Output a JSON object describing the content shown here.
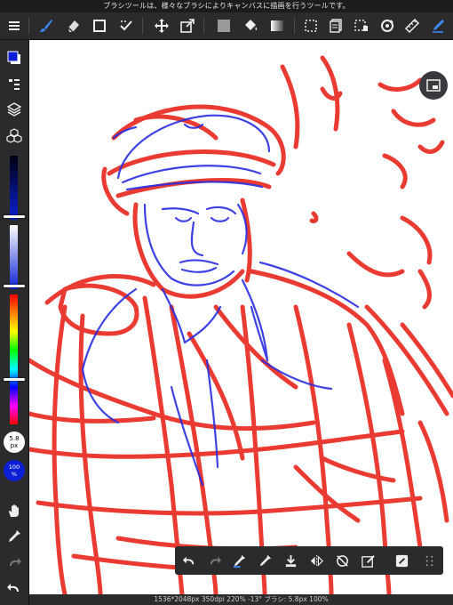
{
  "hint": "ブラシツールは、様々なブラシによりキャンバスに描画を行うツールです。",
  "colors": {
    "chrome": "#2b2b2e",
    "accent": "#1e6cf2",
    "primary_color": "#0b1fd6",
    "sketch_red": "#e8261c",
    "sketch_blue": "#2a2de0"
  },
  "toolbar": {
    "items": [
      "menu-icon",
      "brush-icon",
      "eraser-icon",
      "rect-icon",
      "magic-wand-icon",
      "move-icon",
      "transform-icon",
      "fill-color-icon",
      "bucket-icon",
      "gradient-icon",
      "selection-icon",
      "layer-copy-icon",
      "selection-edit-icon",
      "rotate-icon",
      "ruler-icon",
      "pen-active-icon"
    ]
  },
  "sidebar": {
    "brush_size": "5.8",
    "brush_size_unit": "px",
    "brush_opacity": "100",
    "brush_opacity_unit": "%"
  },
  "bottom_toolbar": {
    "items": [
      "undo-icon",
      "redo-icon",
      "eyedropper-blue-icon",
      "dropper-icon",
      "import-icon",
      "flip-icon",
      "rotate-cancel-icon",
      "edit-icon",
      "tag-icon",
      "grid-icon"
    ]
  },
  "status": "1536*2048px 350dpi 220% -13° ブラシ: 5.8px 100%"
}
